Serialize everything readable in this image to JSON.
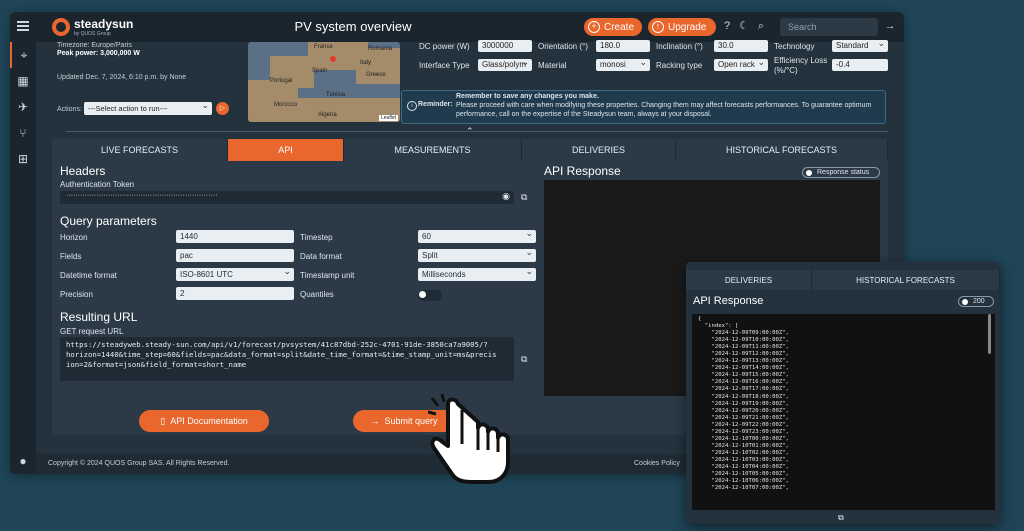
{
  "header": {
    "logo_text": "steadysun",
    "logo_sub": "by QUOS Group",
    "title": "PV system overview",
    "create_label": "Create",
    "upgrade_label": "Upgrade",
    "search_placeholder": "Search"
  },
  "site": {
    "timezone": "Timezone: Europe/Paris",
    "peak_power": "Peak power: 3,000,000 W",
    "updated": "Updated Dec. 7, 2024, 6:10 p.m. by None",
    "actions_label": "Actions:",
    "actions_select": "---Select action to run---"
  },
  "map": {
    "labels": [
      "France",
      "Romania",
      "Spain",
      "Italy",
      "Portugal",
      "Greece",
      "Tunisia",
      "Morocco",
      "Algeria"
    ],
    "leaflet": "Leaflet"
  },
  "properties": {
    "dc_power_label": "DC power (W)",
    "dc_power_value": "3000000",
    "orientation_label": "Orientation (°)",
    "orientation_value": "180.0",
    "inclination_label": "Inclination (°)",
    "inclination_value": "30.0",
    "technology_label": "Technology",
    "technology_value": "Standard",
    "interface_type_label": "Interface Type",
    "interface_type_value": "Glass/polym",
    "material_label": "Material",
    "material_value": "monosi",
    "racking_type_label": "Racking type",
    "racking_type_value": "Open rack",
    "efficiency_loss_label": "Efficiency Loss (%/°C)",
    "efficiency_loss_value": "-0.4"
  },
  "reminder": {
    "label": "Reminder:",
    "line1": "Remember to save any changes you make.",
    "line2": "Please proceed with care when modifying these properties. Changing them may affect forecasts performances. To guarantee optimum performance, call on the expertise of the Steadysun team, always at your disposal."
  },
  "tabs": [
    "LIVE FORECASTS",
    "API",
    "MEASUREMENTS",
    "DELIVERIES",
    "HISTORICAL FORECASTS"
  ],
  "api": {
    "headers_title": "Headers",
    "auth_label": "Authentication Token",
    "auth_value": "·································································",
    "query_title": "Query parameters",
    "horizon_label": "Horizon",
    "horizon_value": "1440",
    "timestep_label": "Timestep",
    "timestep_value": "60",
    "fields_label": "Fields",
    "fields_value": "pac",
    "data_format_label": "Data format",
    "data_format_value": "Split",
    "datetime_label": "Datetime format",
    "datetime_value": "ISO-8601 UTC",
    "timestamp_label": "Timestamp unit",
    "timestamp_value": "Milliseconds",
    "precision_label": "Precision",
    "precision_value": "2",
    "quantiles_label": "Quantiles",
    "url_title": "Resulting URL",
    "get_label": "GET request URL",
    "url_line1": "https://steadyweb.steady-sun.com/api/v1/forecast/pvsystem/41c87dbd-252c-4701-91de-3850ca7a9005/?",
    "url_line2": "horizon=1440&time_step=60&fields=pac&data_format=split&date_time_format=&time_stamp_unit=ms&precis",
    "url_line3": "ion=2&format=json&field_format=short_name",
    "doc_button": "API Documentation",
    "submit_button": "Submit query",
    "response_title": "API Response",
    "response_status": "Response status"
  },
  "footer": {
    "copyright": "Copyright © 2024 QUOS Group SAS. All Rights Reserved.",
    "cookies": "Cookies Policy"
  },
  "popup": {
    "tabs": [
      "DELIVERIES",
      "HISTORICAL FORECASTS"
    ],
    "title": "API Response",
    "status": "200",
    "json_lines": [
      "{",
      "  \"index\": [",
      "    \"2024-12-09T09:00:00Z\",",
      "    \"2024-12-09T10:00:00Z\",",
      "    \"2024-12-09T11:00:00Z\",",
      "    \"2024-12-09T12:00:00Z\",",
      "    \"2024-12-09T13:00:00Z\",",
      "    \"2024-12-09T14:00:00Z\",",
      "    \"2024-12-09T15:00:00Z\",",
      "    \"2024-12-09T16:00:00Z\",",
      "    \"2024-12-09T17:00:00Z\",",
      "    \"2024-12-09T18:00:00Z\",",
      "    \"2024-12-09T19:00:00Z\",",
      "    \"2024-12-09T20:00:00Z\",",
      "    \"2024-12-09T21:00:00Z\",",
      "    \"2024-12-09T22:00:00Z\",",
      "    \"2024-12-09T23:00:00Z\",",
      "    \"2024-12-10T00:00:00Z\",",
      "    \"2024-12-10T01:00:00Z\",",
      "    \"2024-12-10T02:00:00Z\",",
      "    \"2024-12-10T03:00:00Z\",",
      "    \"2024-12-10T04:00:00Z\",",
      "    \"2024-12-10T05:00:00Z\",",
      "    \"2024-12-10T06:00:00Z\",",
      "    \"2024-12-10T07:00:00Z\","
    ]
  },
  "colors": {
    "accent": "#e9662c",
    "panel": "#2b3a46",
    "background": "#1f4557"
  },
  "icons": [
    "menu-icon",
    "location-icon",
    "building-icon",
    "plane-icon",
    "network-icon",
    "hierarchy-icon",
    "user-icon",
    "help-icon",
    "moon-icon",
    "search-icon",
    "arrow-right-icon",
    "eye-icon",
    "copy-icon",
    "book-icon",
    "pointer-hand-icon"
  ]
}
